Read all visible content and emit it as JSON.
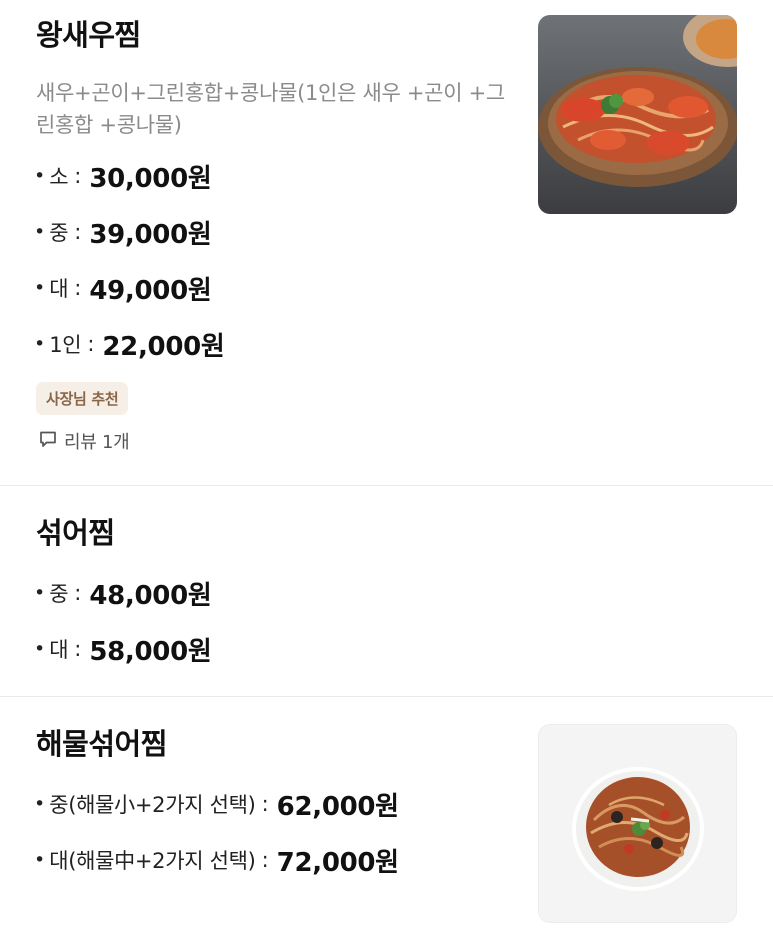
{
  "menu_items": [
    {
      "name": "왕새우찜",
      "description": "새우+곤이+그린홍합+콩나물(1인은 새우 +곤이 +그린홍합 +콩나물)",
      "bullet": "•",
      "colon": ":",
      "prices": [
        {
          "size": "소",
          "price": "30,000원"
        },
        {
          "size": "중",
          "price": "39,000원"
        },
        {
          "size": "대",
          "price": "49,000원"
        },
        {
          "size": "1인",
          "price": "22,000원"
        }
      ],
      "badge": "사장님 추천",
      "review": {
        "icon": "chat-bubble-icon",
        "label": "리뷰 1개"
      }
    },
    {
      "name": "섞어찜",
      "prices": [
        {
          "size": "중",
          "price": "48,000원"
        },
        {
          "size": "대",
          "price": "58,000원"
        }
      ]
    },
    {
      "name": "해물섞어찜",
      "prices": [
        {
          "size": "중(해물小+2가지 선택)",
          "price": "62,000원"
        },
        {
          "size": "대(해물中+2가지 선택)",
          "price": "72,000원"
        }
      ]
    }
  ],
  "colors": {
    "text_primary": "#111111",
    "text_secondary": "#8b8b8b",
    "badge_bg": "#f6efe7",
    "badge_text": "#8a6648",
    "divider": "#ebebeb"
  }
}
